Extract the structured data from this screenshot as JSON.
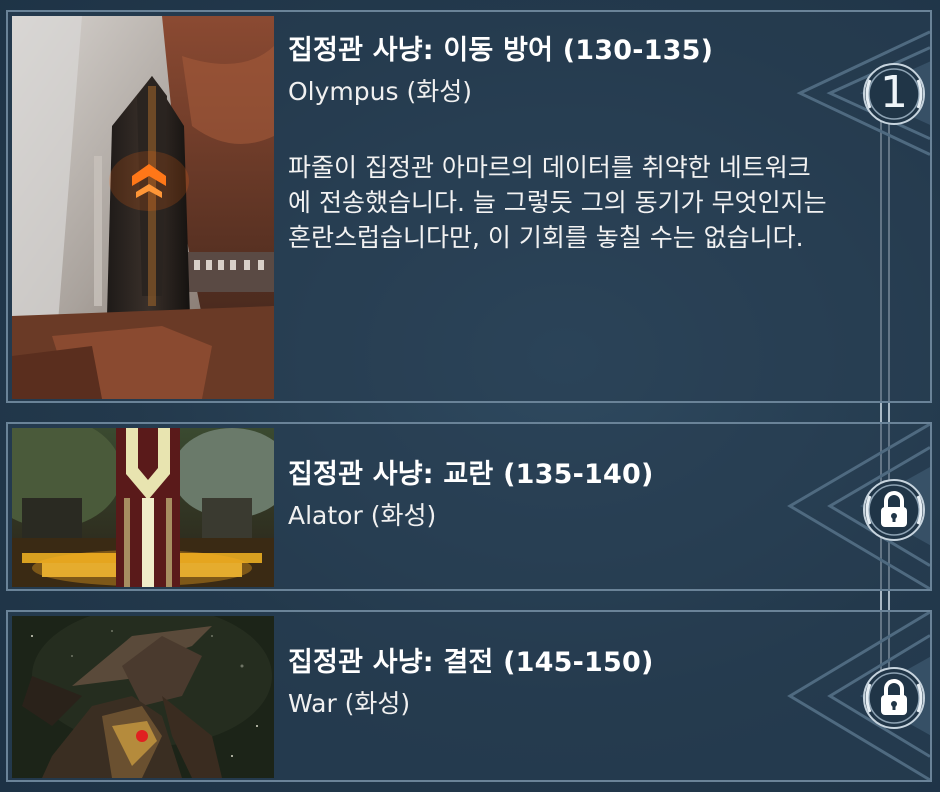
{
  "missions": [
    {
      "title": "집정관 사냥: 이동 방어 (130-135)",
      "location": "Olympus (화성)",
      "description": "파줄이 집정관 아마르의 데이터를 취약한 네트워크에 전송했습니다. 늘 그렇듯 그의 동기가 무엇인지는 혼란스럽습니다만, 이 기회를 놓칠 수는 없습니다.",
      "status_icon": "number-badge",
      "badge_text": "1"
    },
    {
      "title": "집정관 사냥: 교란 (135-140)",
      "location": "Alator (화성)",
      "status_icon": "lock-icon"
    },
    {
      "title": "집정관 사냥: 결전 (145-150)",
      "location": "War (화성)",
      "status_icon": "lock-icon"
    }
  ],
  "colors": {
    "background": "#223a4e",
    "card_border": "#6a8398",
    "accent_orange": "#ff7a1a",
    "accent_yellow": "#e8d86a"
  }
}
